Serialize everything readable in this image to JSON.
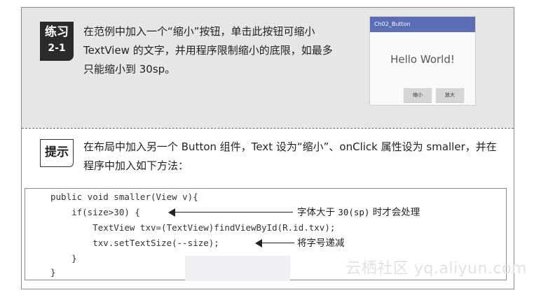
{
  "exercise": {
    "badge_title": "练习",
    "badge_number": "2-1",
    "text": "在范例中加入一个“缩小”按钮，单击此按钮可缩小 TextView 的文字，并用程序限制缩小的底限，如最多只能缩小到 30sp。"
  },
  "phone": {
    "app_title": "Ch02_Button",
    "hello_text": "Hello World!",
    "buttons": [
      "缩小",
      "放大"
    ],
    "appbar_color": "#5a6db5"
  },
  "hint": {
    "badge": "提示",
    "text": "在布局中加入另一个 Button 组件，Text 设为“缩小”、onClick 属性设为 smaller，并在程序中加入如下方法："
  },
  "code": {
    "lines": [
      "public void smaller(View v){",
      "    if(size>30) {",
      "        TextView txv=(TextView)findViewById(R.id.txv);",
      "        txv.setTextSize(--size);",
      "    }",
      "}"
    ],
    "annotations": {
      "a1_prefix": "字体大于 ",
      "a1_value": "30(sp)",
      "a1_suffix": " 时才会处理",
      "a2": "将字号递减"
    }
  },
  "watermark": "云栖社区 yq.aliyun.com"
}
